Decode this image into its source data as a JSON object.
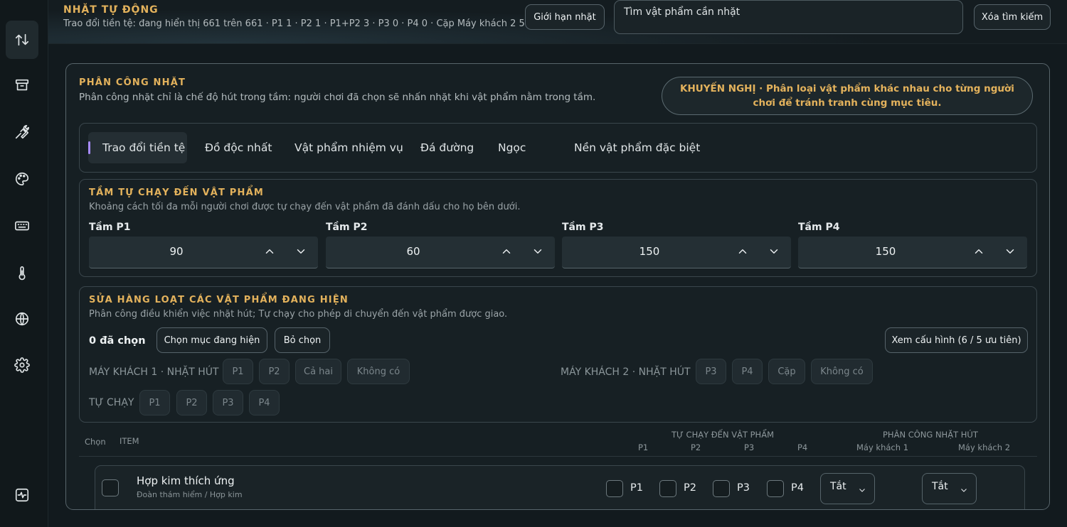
{
  "header": {
    "title": "NHẶT TỰ ĐỘNG",
    "status": "Trao đổi tiền tệ: đang hiển thị 661 trên 661 · P1 1 · P2 1 · P1+P2 3 · P3 0 · P4 0 · Cặp Máy khách 2 5",
    "limit_button": "Giới hạn nhặt",
    "search_placeholder": "Tìm vật phẩm cần nhặt",
    "clear_button": "Xóa tìm kiếm"
  },
  "panel": {
    "title": "PHÂN CÔNG NHẶT",
    "subtitle": "Phân công nhặt chỉ là chế độ hút trong tầm: người chơi đã chọn sẽ nhấn nhặt khi vật phẩm nằm trong tầm.",
    "recommendation": "KHUYẾN NGHỊ · Phân loại vật phẩm khác nhau cho từng người chơi để tránh tranh cùng mục tiêu."
  },
  "tabs": [
    {
      "label": "Trao đổi tiền tệ"
    },
    {
      "label": "Đồ độc nhất"
    },
    {
      "label": "Vật phẩm nhiệm vụ"
    },
    {
      "label": "Đá đường"
    },
    {
      "label": "Ngọc"
    },
    {
      "label": "Nền vật phẩm đặc biệt"
    }
  ],
  "range": {
    "title": "TẦM TỰ CHẠY ĐẾN VẬT PHẨM",
    "subtitle": "Khoảng cách tối đa mỗi người chơi được tự chạy đến vật phẩm đã đánh dấu cho họ bên dưới.",
    "fields": [
      {
        "label": "Tầm P1",
        "value": "90"
      },
      {
        "label": "Tầm P2",
        "value": "60"
      },
      {
        "label": "Tầm P3",
        "value": "150"
      },
      {
        "label": "Tầm P4",
        "value": "150"
      }
    ]
  },
  "bulk": {
    "title": "SỬA HÀNG LOẠT CÁC VẬT PHẨM ĐANG HIỆN",
    "subtitle": "Phân công điều khiển việc nhặt hút; Tự chạy cho phép di chuyển đến vật phẩm được giao.",
    "selected_count": "0 đã chọn",
    "select_visible": "Chọn mục đang hiện",
    "deselect": "Bỏ chọn",
    "view_config": "Xem cấu hình (6 / 5 ưu tiên)",
    "client1_label": "MÁY KHÁCH 1 · NHẶT HÚT",
    "client1_options": [
      "P1",
      "P2",
      "Cả hai",
      "Không có"
    ],
    "client2_label": "MÁY KHÁCH 2 · NHẶT HÚT",
    "client2_options": [
      "P3",
      "P4",
      "Cặp",
      "Không có"
    ],
    "autorun_label": "TỰ CHẠY",
    "autorun_options": [
      "P1",
      "P2",
      "P3",
      "P4"
    ]
  },
  "table": {
    "col_select": "Chọn",
    "col_item": "ITEM",
    "col_autorun": "TỰ CHẠY ĐẾN VẬT PHẨM",
    "autorun_sub": [
      "P1",
      "P2",
      "P3",
      "P4"
    ],
    "col_assign": "PHÂN CÔNG NHẶT HÚT",
    "assign_sub": [
      "Máy khách 1",
      "Máy khách 2"
    ],
    "rows": [
      {
        "name": "Hợp kim thích ứng",
        "path": "Đoàn thám hiểm / Hợp kim",
        "players": [
          "P1",
          "P2",
          "P3",
          "P4"
        ],
        "client1": "Tắt",
        "client2": "Tắt"
      }
    ]
  }
}
